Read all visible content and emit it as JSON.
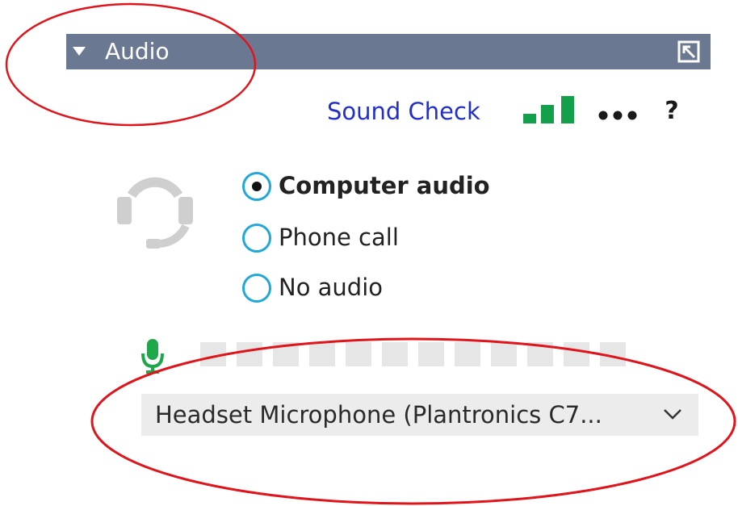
{
  "window": {
    "title": "Audio"
  },
  "toolbar": {
    "sound_check_label": "Sound Check",
    "help_label": "?"
  },
  "icons": {
    "collapse": "triangle-down-icon",
    "popout": "popout-icon",
    "signal": "signal-bars-icon",
    "more": "ellipsis-icon",
    "headset": "headset-icon",
    "microphone": "microphone-icon",
    "chevron": "chevron-down-icon"
  },
  "audio_options": [
    {
      "label": "Computer audio",
      "selected": true
    },
    {
      "label": "Phone call",
      "selected": false
    },
    {
      "label": "No audio",
      "selected": false
    }
  ],
  "microphone": {
    "level": 0,
    "segments": 12,
    "device": "Headset Microphone (Plantronics C7..."
  },
  "colors": {
    "titlebar": "#6b7891",
    "link": "#2230c7",
    "radio_ring": "#22a7d6",
    "signal_green": "#12a04a",
    "mic_green": "#1ea84a",
    "annotation_red": "#e0141b"
  }
}
